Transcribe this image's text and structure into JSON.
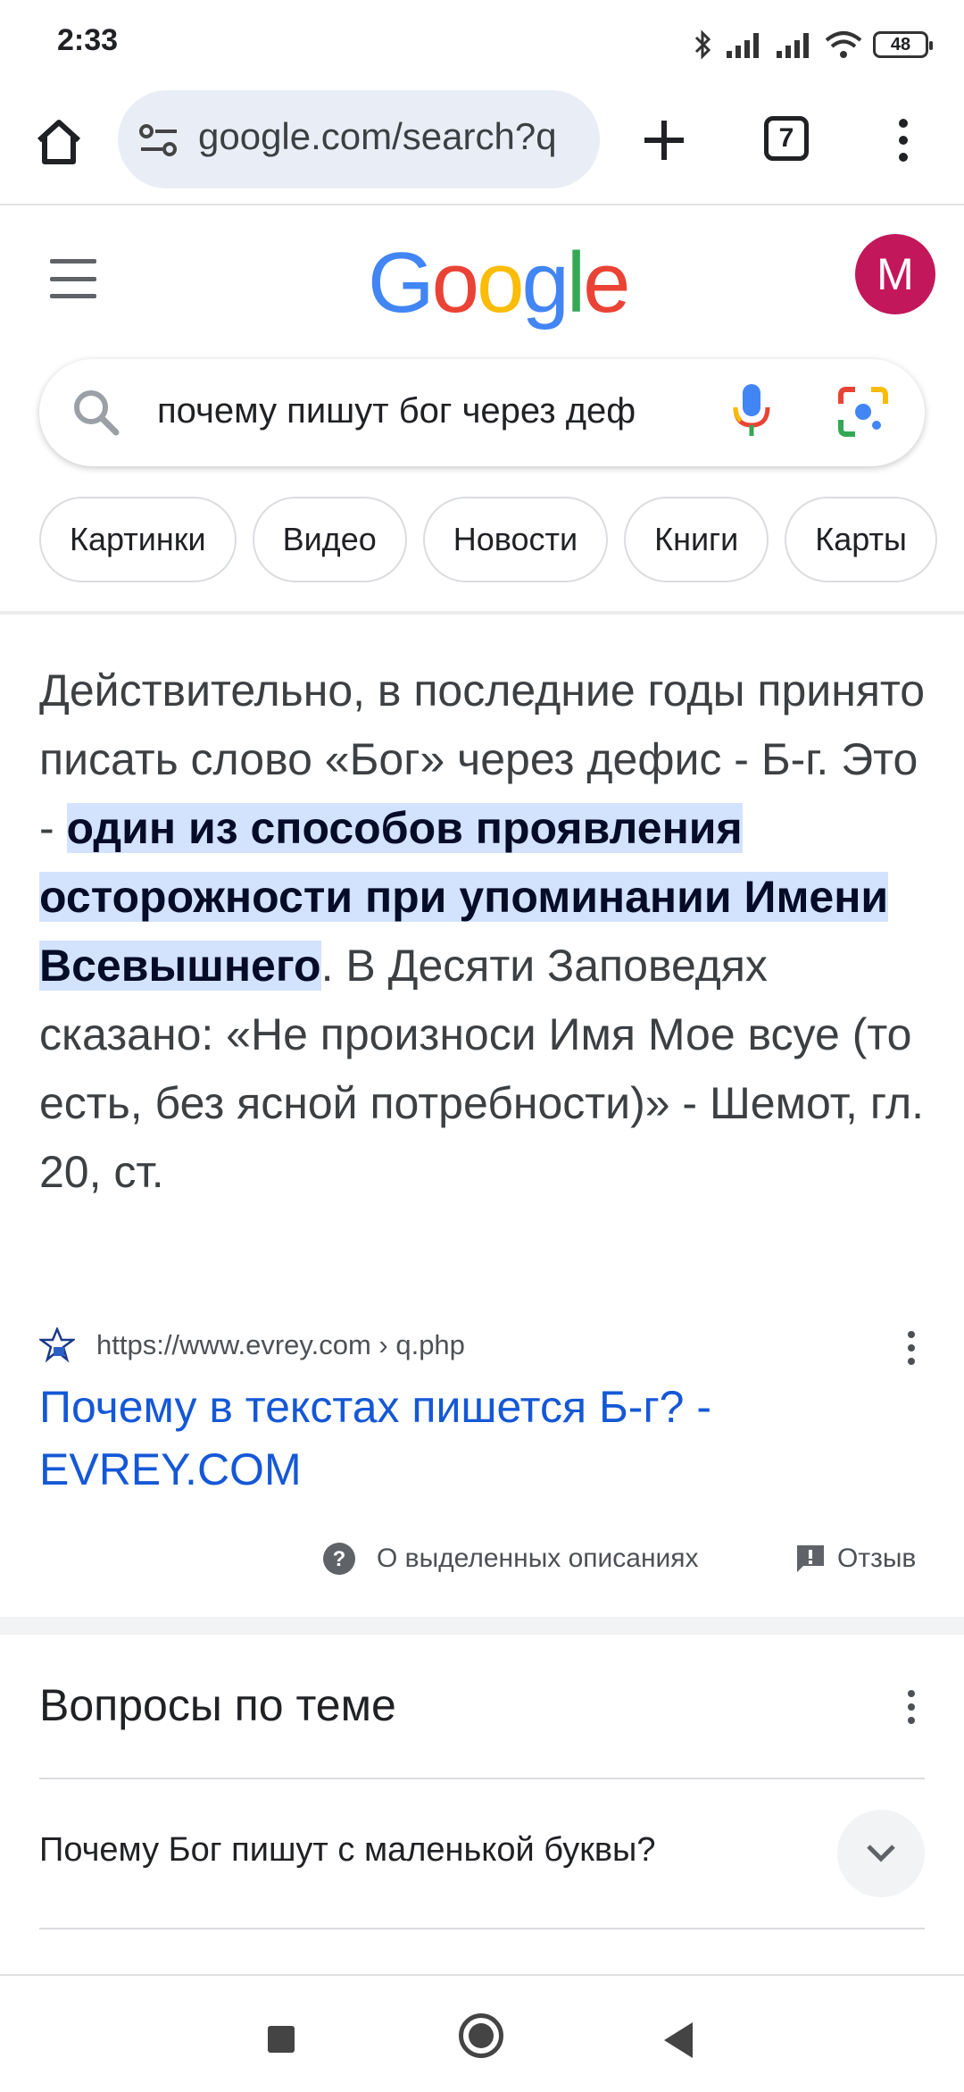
{
  "status_bar": {
    "time": "2:33",
    "battery": "48"
  },
  "browser": {
    "url": "google.com/search?q",
    "tab_count": "7"
  },
  "header": {
    "logo_letters": [
      {
        "ch": "G",
        "color": "#4285F4"
      },
      {
        "ch": "o",
        "color": "#EA4335"
      },
      {
        "ch": "o",
        "color": "#FBBC05"
      },
      {
        "ch": "g",
        "color": "#4285F4"
      },
      {
        "ch": "l",
        "color": "#34A853"
      },
      {
        "ch": "e",
        "color": "#EA4335"
      }
    ],
    "avatar_letter": "M"
  },
  "search": {
    "query": "почему пишут бог через деф"
  },
  "chips": [
    "Картинки",
    "Видео",
    "Новости",
    "Книги",
    "Карты"
  ],
  "snippet": {
    "before": "Действительно, в последние годы принято писать слово «Бог» через дефис - Б-г. Это - ",
    "highlight": "один из способов проявления осторожности при упоминании Имени Всевышнего",
    "after": ". В Десяти Заповедях сказано: «Не произноси Имя Мое всуе (то есть, без ясной потребности)» - Шемот, гл. 20, ст.",
    "source_url": "https://www.evrey.com › q.php",
    "title": "Почему в текстах пишется Б-г? - EVREY.COM",
    "about_label": "О выделенных описаниях",
    "feedback_label": "Отзыв"
  },
  "related": {
    "title": "Вопросы по теме",
    "questions": [
      "Почему Бог пишут с маленькой буквы?"
    ]
  },
  "colors": {
    "accent_link": "#1558d6",
    "highlight": "#d3e3fd",
    "avatar": "#c2185b"
  }
}
